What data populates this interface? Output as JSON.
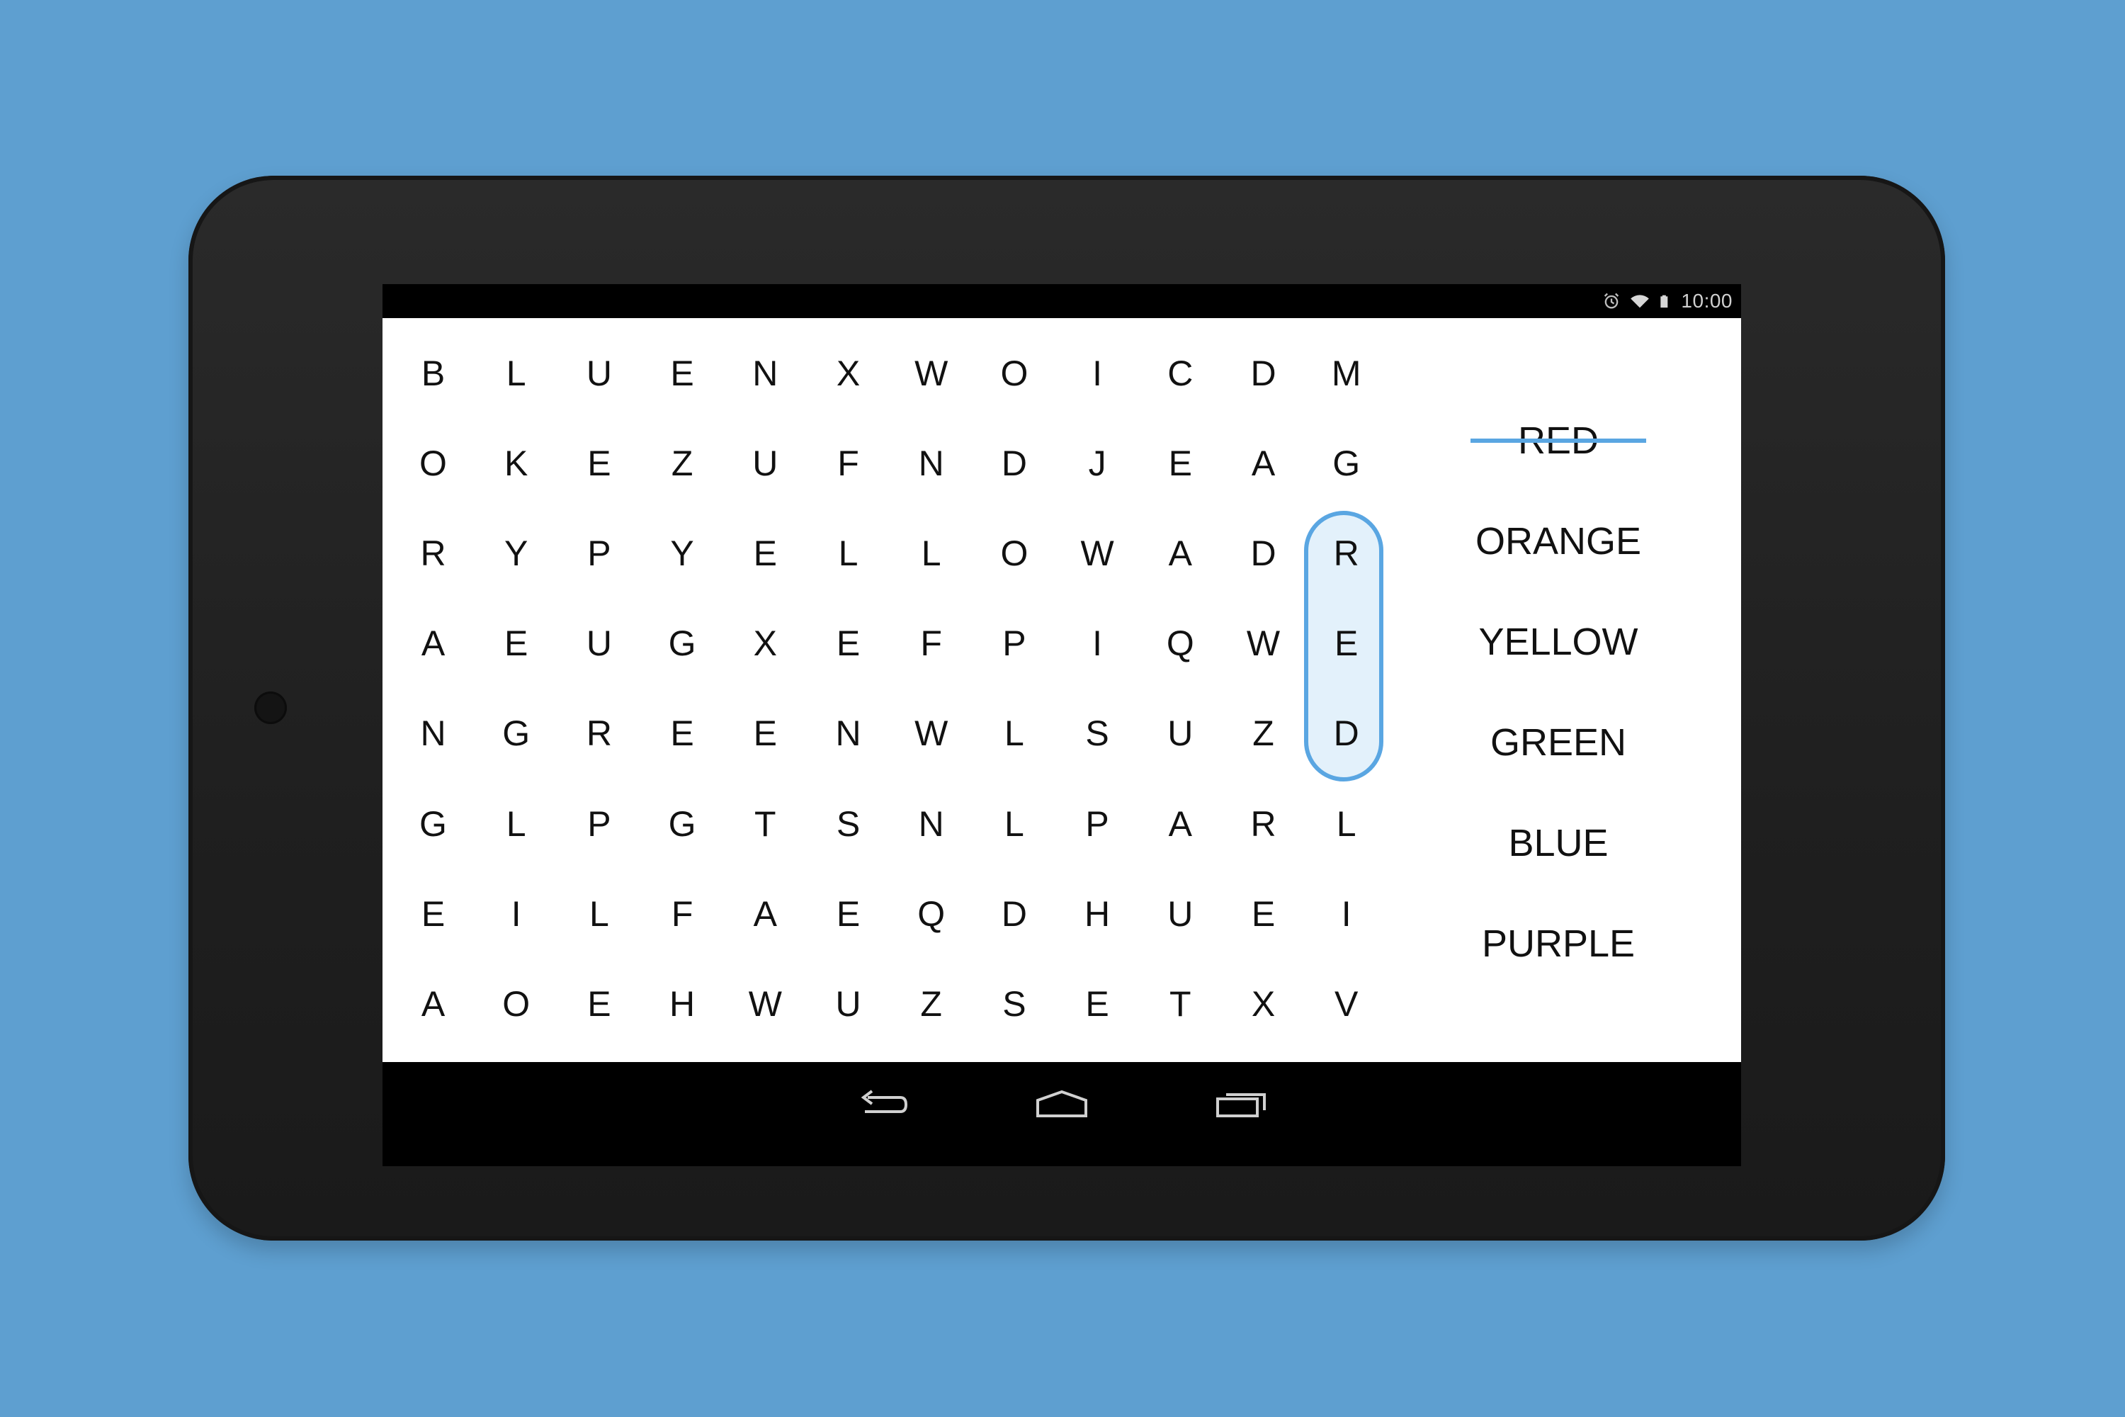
{
  "status_bar": {
    "time": "10:00",
    "icons": [
      "alarm-icon",
      "wifi-icon",
      "battery-icon"
    ]
  },
  "grid": {
    "rows": [
      [
        "B",
        "L",
        "U",
        "E",
        "N",
        "X",
        "W",
        "O",
        "I",
        "C",
        "D",
        "M"
      ],
      [
        "O",
        "K",
        "E",
        "Z",
        "U",
        "F",
        "N",
        "D",
        "J",
        "E",
        "A",
        "G"
      ],
      [
        "R",
        "Y",
        "P",
        "Y",
        "E",
        "L",
        "L",
        "O",
        "W",
        "A",
        "D",
        "R"
      ],
      [
        "A",
        "E",
        "U",
        "G",
        "X",
        "E",
        "F",
        "P",
        "I",
        "Q",
        "W",
        "E"
      ],
      [
        "N",
        "G",
        "R",
        "E",
        "E",
        "N",
        "W",
        "L",
        "S",
        "U",
        "Z",
        "D"
      ],
      [
        "G",
        "L",
        "P",
        "G",
        "T",
        "S",
        "N",
        "L",
        "P",
        "A",
        "R",
        "L"
      ],
      [
        "E",
        "I",
        "L",
        "F",
        "A",
        "E",
        "Q",
        "D",
        "H",
        "U",
        "E",
        "I"
      ],
      [
        "A",
        "O",
        "E",
        "H",
        "W",
        "U",
        "Z",
        "S",
        "E",
        "T",
        "X",
        "V"
      ]
    ],
    "selection": {
      "column": 11,
      "row_start": 2,
      "row_end": 4
    }
  },
  "words": [
    {
      "text": "RED",
      "found": true
    },
    {
      "text": "ORANGE",
      "found": false
    },
    {
      "text": "YELLOW",
      "found": false
    },
    {
      "text": "GREEN",
      "found": false
    },
    {
      "text": "BLUE",
      "found": false
    },
    {
      "text": "PURPLE",
      "found": false
    }
  ],
  "nav": {
    "buttons": [
      "back-icon",
      "home-icon",
      "recent-apps-icon"
    ]
  },
  "colors": {
    "background": "#5e9fd0",
    "accent": "#5aa6e2",
    "selection_fill": "#e3f1fb",
    "device": "#222222"
  }
}
